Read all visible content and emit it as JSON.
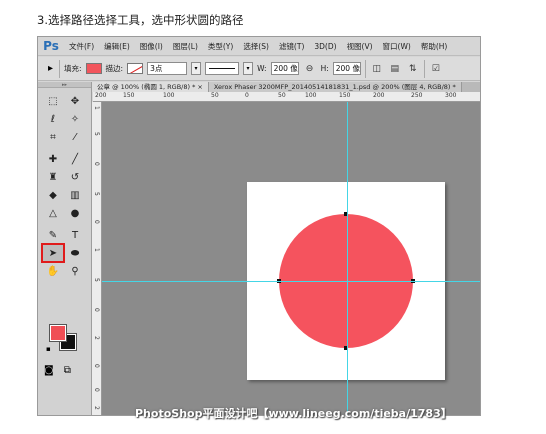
{
  "caption": "3.选择路径选择工具，选中形状圆的路径",
  "app": {
    "logo": "Ps",
    "menu": [
      "文件(F)",
      "编辑(E)",
      "图像(I)",
      "图层(L)",
      "类型(Y)",
      "选择(S)",
      "滤镜(T)",
      "3D(D)",
      "视图(V)",
      "窗口(W)",
      "帮助(H)"
    ]
  },
  "options_bar": {
    "fill_label": "填充:",
    "fill_color": "#f2555c",
    "stroke_label": "描边:",
    "stroke_width": "3点",
    "w_label": "W:",
    "w_value": "200 像",
    "link_icon": "link-icon",
    "h_label": "H:",
    "h_value": "200 像"
  },
  "tabs": [
    {
      "label": "公章 @ 100% (椭圆 1, RGB/8) * ×",
      "active": true
    },
    {
      "label": "Xerox Phaser 3200MFP_20140514181831_1.psd @ 200% (图层 4, RGB/8) *",
      "active": false
    }
  ],
  "ruler_top_ticks": [
    "200",
    "150",
    "100",
    "50",
    "0",
    "50",
    "100",
    "150",
    "200",
    "250",
    "300"
  ],
  "ruler_left_ticks": [
    "1",
    "5",
    "0",
    "5",
    "0",
    "1",
    "5",
    "0",
    "2",
    "0",
    "0",
    "2"
  ],
  "colors": {
    "foreground": "#f04e55",
    "background": "#111111",
    "shape_fill": "#f5535e",
    "guide": "#44d6e6"
  },
  "watermark": "PhotoShop平面设计吧【www.lineeg.com/tieba/1783】"
}
